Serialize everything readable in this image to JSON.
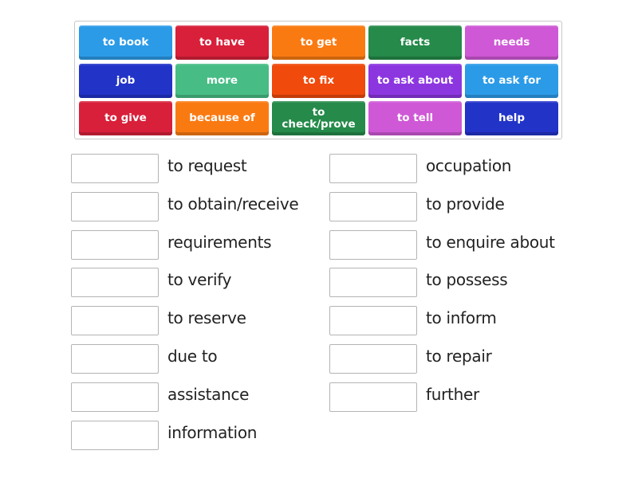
{
  "tiles": [
    {
      "label": "to book",
      "color": "#2b9be8"
    },
    {
      "label": "to have",
      "color": "#d8203a"
    },
    {
      "label": "to get",
      "color": "#fa7a12"
    },
    {
      "label": "facts",
      "color": "#258a4a"
    },
    {
      "label": "needs",
      "color": "#cf58d6"
    },
    {
      "label": "job",
      "color": "#2233c8"
    },
    {
      "label": "more",
      "color": "#47bd85"
    },
    {
      "label": "to fix",
      "color": "#f04a0c"
    },
    {
      "label": "to ask about",
      "color": "#8c36e0"
    },
    {
      "label": "to ask for",
      "color": "#2b9be8"
    },
    {
      "label": "to give",
      "color": "#d8203a"
    },
    {
      "label": "because of",
      "color": "#fa7a12"
    },
    {
      "label": "to check/prove",
      "color": "#258a4a"
    },
    {
      "label": "to tell",
      "color": "#cf58d6"
    },
    {
      "label": "help",
      "color": "#2233c8"
    }
  ],
  "targets": {
    "left": [
      {
        "label": "to request"
      },
      {
        "label": "to obtain/receive"
      },
      {
        "label": "requirements"
      },
      {
        "label": "to verify"
      },
      {
        "label": "to reserve"
      },
      {
        "label": "due to"
      },
      {
        "label": "assistance"
      },
      {
        "label": "information"
      }
    ],
    "right": [
      {
        "label": "occupation"
      },
      {
        "label": "to provide"
      },
      {
        "label": "to enquire about"
      },
      {
        "label": "to possess"
      },
      {
        "label": "to inform"
      },
      {
        "label": "to repair"
      },
      {
        "label": "further"
      }
    ]
  }
}
